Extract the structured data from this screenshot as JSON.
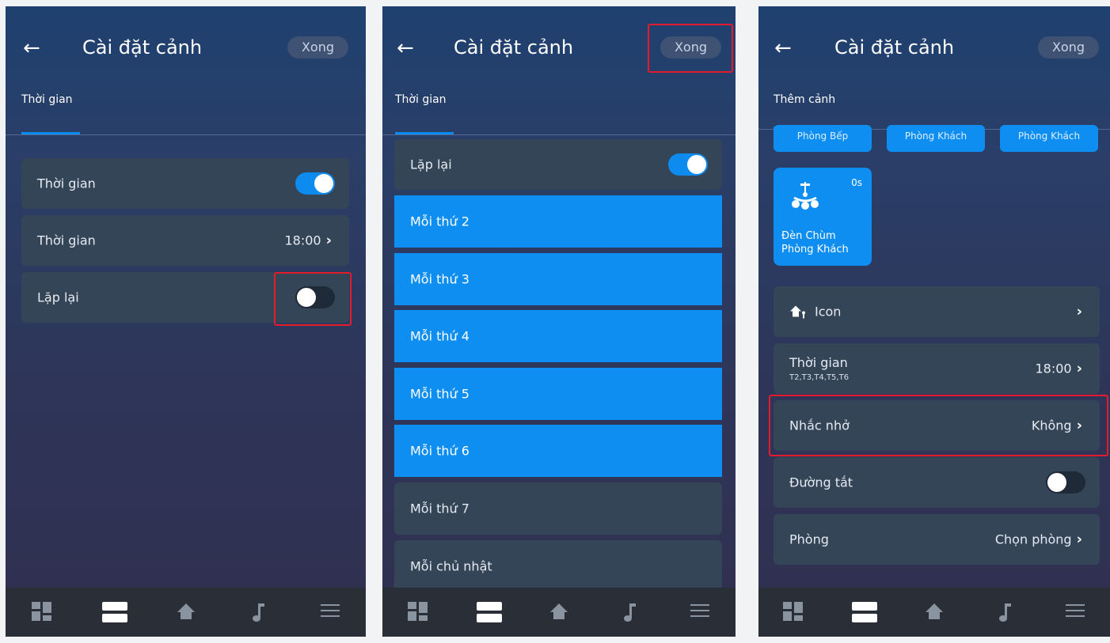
{
  "screens": [
    {
      "header": {
        "back_icon": "arrow-left-icon",
        "title": "Cài đặt cảnh",
        "done_label": "Xong"
      },
      "tab_label": "Thời gian",
      "rows": {
        "time_toggle": {
          "label": "Thời gian",
          "toggle": "on"
        },
        "time_value": {
          "label": "Thời gian",
          "value": "18:00"
        },
        "repeat": {
          "label": "Lặp lại",
          "toggle": "off"
        }
      }
    },
    {
      "header": {
        "back_icon": "arrow-left-icon",
        "title": "Cài đặt cảnh",
        "done_label": "Xong"
      },
      "tab_label": "Thời gian",
      "repeat": {
        "label": "Lặp lại",
        "toggle": "on"
      },
      "days": [
        {
          "label": "Mỗi thứ 2",
          "selected": true
        },
        {
          "label": "Mỗi thứ 3",
          "selected": true
        },
        {
          "label": "Mỗi thứ 4",
          "selected": true
        },
        {
          "label": "Mỗi thứ 5",
          "selected": true
        },
        {
          "label": "Mỗi thứ 6",
          "selected": true
        },
        {
          "label": "Mỗi thứ 7",
          "selected": false
        },
        {
          "label": "Mỗi chủ nhật",
          "selected": false
        }
      ]
    },
    {
      "header": {
        "back_icon": "arrow-left-icon",
        "title": "Cài đặt cảnh",
        "done_label": "Xong"
      },
      "tab_label": "Thêm cảnh",
      "chips": [
        "Phòng Bếp",
        "Phòng Khách",
        "Phòng Khách"
      ],
      "device": {
        "time": "0s",
        "name_line1": "Đèn Chùm",
        "name_line2": "Phòng Khách",
        "icon": "chandelier-icon"
      },
      "rows": {
        "icon": {
          "label": "Icon",
          "icon": "home-person-icon"
        },
        "time": {
          "label": "Thời gian",
          "sub": "T2,T3,T4,T5,T6",
          "value": "18:00"
        },
        "reminder": {
          "label": "Nhắc nhở",
          "value": "Không"
        },
        "shortcut": {
          "label": "Đường tắt",
          "toggle": "off"
        },
        "room": {
          "label": "Phòng",
          "value": "Chọn phòng"
        }
      }
    }
  ],
  "navbar": {
    "icons": [
      "dashboard-icon",
      "scenes-icon",
      "home-icon",
      "music-icon",
      "menu-icon"
    ],
    "active": "scenes-icon"
  },
  "colors": {
    "accent": "#0f8ef2",
    "highlight": "#e21b2d",
    "card": "#354558"
  }
}
